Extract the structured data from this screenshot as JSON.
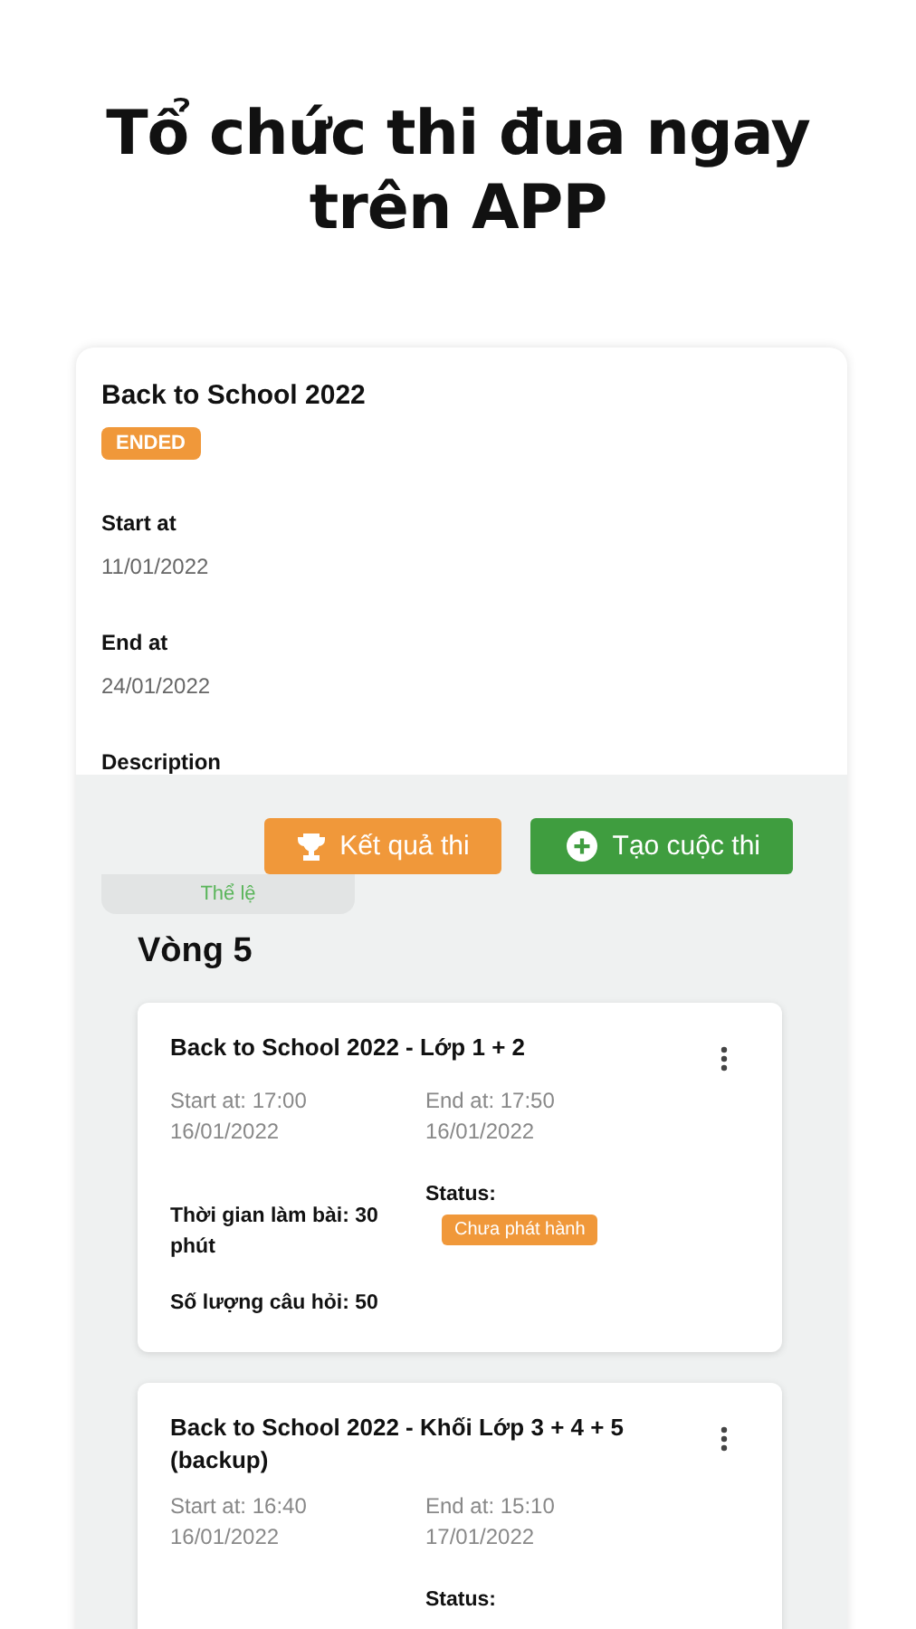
{
  "headline": [
    "Tổ chức thi đua ngay",
    "trên APP"
  ],
  "contest": {
    "title": "Back to School 2022",
    "status": "ENDED",
    "fields": [
      {
        "label": "Start at",
        "value": "11/01/2022"
      },
      {
        "label": "End at",
        "value": "24/01/2022"
      },
      {
        "label": "Description"
      }
    ]
  },
  "actions": [
    {
      "kind": "results",
      "label": "Kết quả thi"
    },
    {
      "kind": "create",
      "label": "Tạo cuộc thi"
    }
  ],
  "tabs": [
    {
      "label": "Thể lệ",
      "selected": true
    }
  ],
  "round": {
    "title": "Vòng 5",
    "exams": [
      {
        "title": "Back to School 2022 - Lớp 1 + 2",
        "start": "Start at: 17:00",
        "start_date": "16/01/2022",
        "end": "End at: 17:50",
        "end_date": "16/01/2022",
        "duration": "Thời gian làm bài: 30 phút",
        "questions": "Số lượng câu hỏi: 50",
        "status_label": "Status:",
        "status": "Chưa phát hành"
      },
      {
        "title": "Back to School 2022 - Khối Lớp 3 + 4 + 5 (backup)",
        "start": "Start at: 16:40",
        "start_date": "16/01/2022",
        "end": "End at: 15:10",
        "end_date": "17/01/2022",
        "status_label": "Status:"
      }
    ]
  }
}
